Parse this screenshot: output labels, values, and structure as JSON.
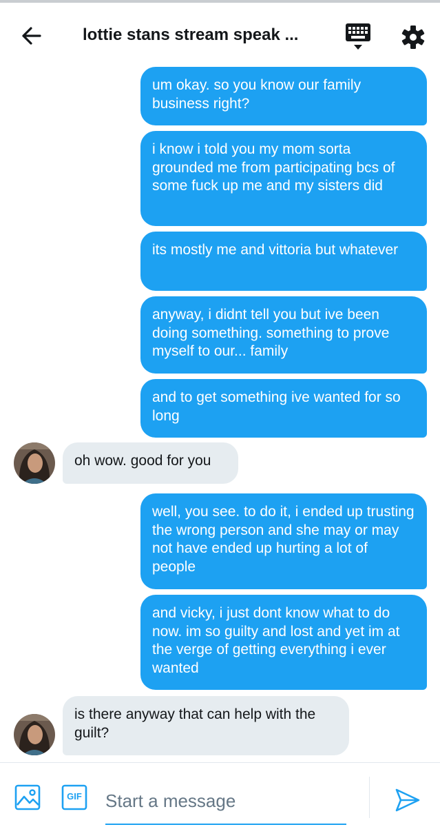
{
  "header": {
    "title": "lottie stans stream speak ...",
    "back_icon": "arrow-left-icon",
    "keyboard_icon": "keyboard-icon",
    "settings_icon": "gear-icon"
  },
  "colors": {
    "accent": "#1da1f2",
    "outgoing_bubble": "#1da1f2",
    "incoming_bubble": "#e6ecf0",
    "text": "#14171a"
  },
  "messages": [
    {
      "from": "me",
      "text": "um okay. so you know our family business right?"
    },
    {
      "from": "me",
      "text": "i know i told you my mom sorta grounded me from participating bcs of some fuck up me and my sisters did"
    },
    {
      "from": "me",
      "text": "its mostly me and vittoria but whatever"
    },
    {
      "from": "me",
      "text": "anyway, i didnt tell you but ive been doing something. something to prove myself to our... family"
    },
    {
      "from": "me",
      "text": "and to get something ive wanted for so long"
    },
    {
      "from": "them",
      "text": "oh wow. good for you"
    },
    {
      "from": "me",
      "text": "well, you see. to do it, i ended up trusting the wrong person and she may or may not have ended up hurting a lot of people"
    },
    {
      "from": "me",
      "text": "and vicky, i just dont know what to do now. im so guilty and lost and yet im at the verge of getting everything i ever wanted"
    },
    {
      "from": "them",
      "text": "is there anyway that can help with the guilt?"
    }
  ],
  "composer": {
    "placeholder": "Start a message",
    "value": "",
    "gif_label": "GIF",
    "image_icon": "image-icon",
    "send_icon": "send-icon"
  }
}
